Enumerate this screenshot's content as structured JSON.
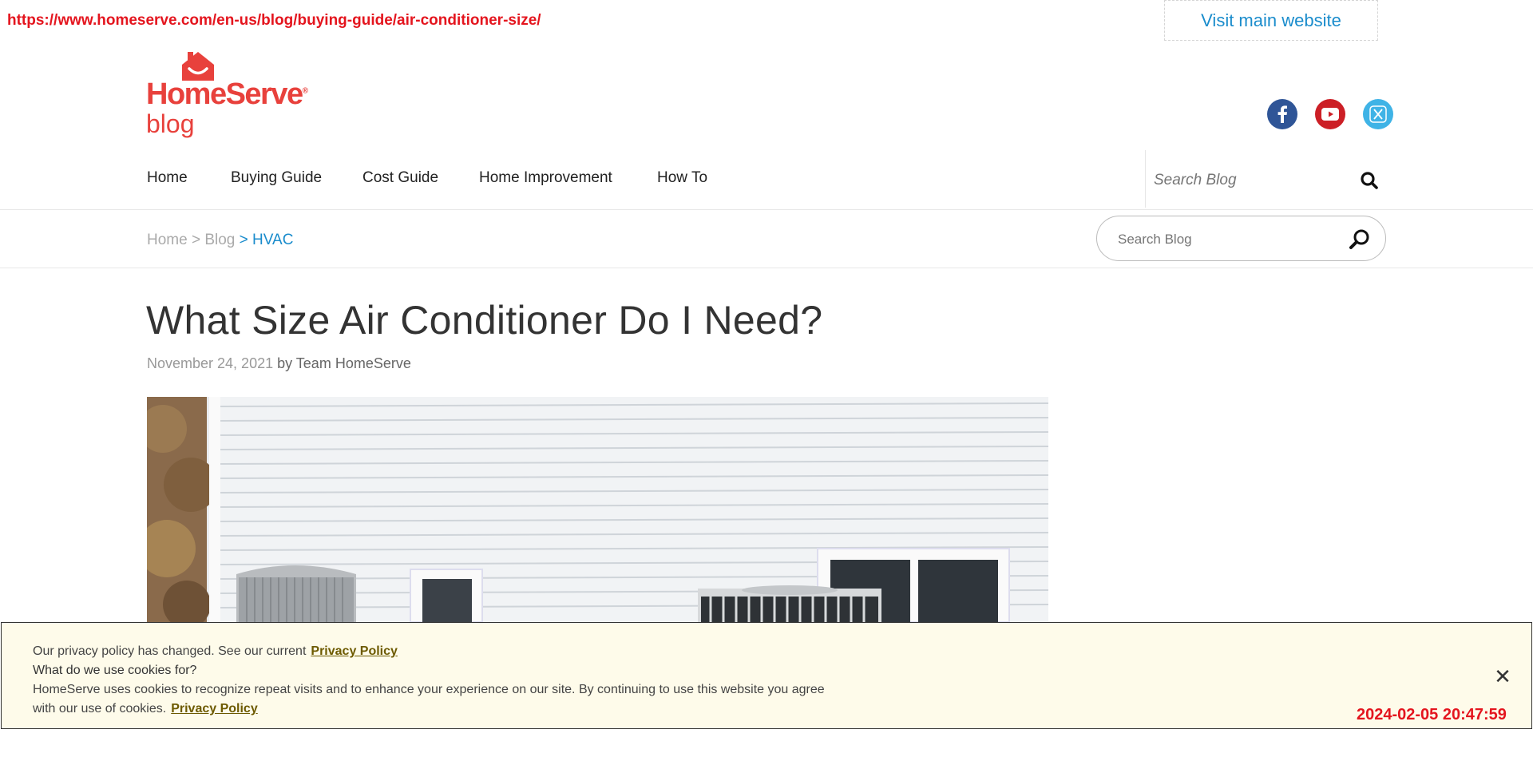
{
  "page": {
    "url": "https://www.homeserve.com/en-us/blog/buying-guide/air-conditioner-size/",
    "timestamp": "2024-02-05 20:47:59"
  },
  "header": {
    "visit_main_label": "Visit main website",
    "logo_word": "HomeServe",
    "logo_reg": "®",
    "logo_sub": "blog",
    "social": [
      "facebook-icon",
      "youtube-icon",
      "x-twitter-icon"
    ],
    "colors": {
      "brand_red": "#e8413c",
      "link_blue": "#1a8ccc",
      "facebook": "#2f5597",
      "youtube": "#cc1f26",
      "x_twitter": "#3fb3e6"
    }
  },
  "nav": {
    "items": [
      {
        "label": "Home"
      },
      {
        "label": "Buying Guide"
      },
      {
        "label": "Cost Guide"
      },
      {
        "label": "Home Improvement"
      },
      {
        "label": "How To"
      }
    ],
    "search_placeholder": "Search Blog"
  },
  "breadcrumb": {
    "home": "Home",
    "sep1": " > ",
    "blog": "Blog",
    "sep2": " > ",
    "current": "HVAC"
  },
  "sidebar_search": {
    "placeholder": "Search Blog"
  },
  "article": {
    "title": "What Size Air Conditioner Do I Need?",
    "date": "November 24, 2021",
    "by": " by Team HomeServe"
  },
  "cookie_banner": {
    "line1_text": "Our privacy policy has changed. See our current",
    "line1_link": "Privacy Policy",
    "heading": "What do we use cookies for?",
    "body1": "HomeServe uses cookies to recognize repeat visits and to enhance your experience on our site. By continuing to use this website you agree",
    "body2": "with our use of cookies.",
    "body2_link": "Privacy Policy",
    "close": "✕"
  }
}
